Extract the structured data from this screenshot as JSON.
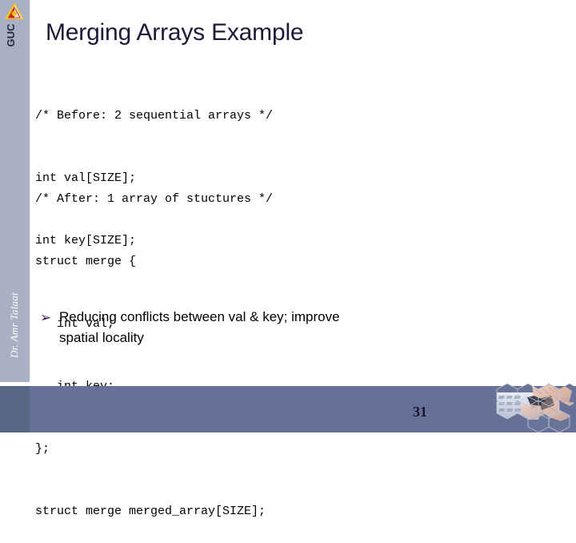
{
  "slide": {
    "title": "Merging Arrays Example",
    "page_number": "31",
    "author": "Dr. Amr Talaat",
    "logo_label": "GUC",
    "logo_icon": "guc-triangle-logo",
    "footer_graphic_icon": "hexagon-keyboard-hands-image"
  },
  "code_before": {
    "lines": [
      "/* Before: 2 sequential arrays */",
      "int val[SIZE];",
      "int key[SIZE];"
    ]
  },
  "code_after": {
    "lines": [
      "/* After: 1 array of stuctures */",
      "struct merge {",
      "   int val;",
      "   int key;",
      "};",
      "struct merge merged_array[SIZE];"
    ]
  },
  "bullet": {
    "marker": "➢",
    "marker_icon": "arrowhead-bullet-icon",
    "text": "Reducing conflicts between val & key; improve spatial locality"
  },
  "colors": {
    "sidebar": "#a7b1c3",
    "footer": "#667099",
    "footer_left": "#566684",
    "title": "#1b1b38",
    "bullet_marker": "#3b1055",
    "page_number": "#15152e"
  }
}
